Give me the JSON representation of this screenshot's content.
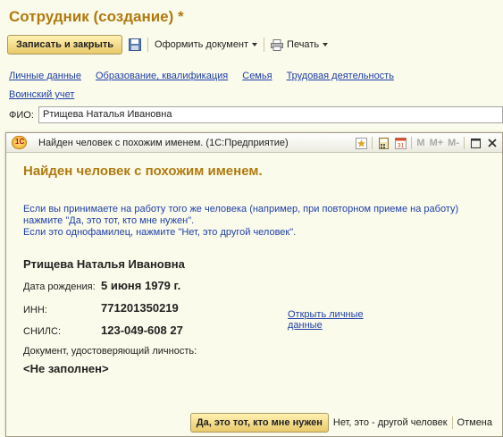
{
  "form": {
    "title": "Сотрудник (создание) *",
    "toolbar": {
      "save_close": "Записать и закрыть",
      "format_doc": "Оформить документ",
      "print": "Печать"
    },
    "tabs_row1": [
      "Личные данные",
      "Образование, квалификация",
      "Семья",
      "Трудовая деятельность"
    ],
    "tabs_row2": [
      "Воинский учет"
    ],
    "fio_label": "ФИО:",
    "fio_value": "Ртищева Наталья Ивановна"
  },
  "dialog": {
    "title": "Найден человек с похожим именем.  (1С:Предприятие)",
    "header_buttons": {
      "m": "M",
      "m_plus": "M+",
      "m_minus": "M-"
    },
    "heading": "Найден человек с похожим именем.",
    "desc_line1": "Если вы принимаете на работу того же человека (например, при повторном приеме на работу)",
    "desc_line2": "нажмите \"Да, это тот, кто мне нужен\".",
    "desc_line3": "Если это однофамилец, нажмите \"Нет, это другой человек\".",
    "person_name": "Ртищева Наталья Ивановна",
    "birth_label": "Дата рождения:",
    "birth_value": "5 июня 1979 г.",
    "inn_label": "ИНН:",
    "inn_value": "771201350219",
    "snils_label": "СНИЛС:",
    "snils_value": "123-049-608 27",
    "open_link_line1": "Открыть личные",
    "open_link_line2": "данные",
    "doc_label": "Документ, удостоверяющий личность:",
    "doc_value": "<Не заполнен>",
    "btn_yes": "Да, это тот, кто мне нужен",
    "btn_no": "Нет, это - другой человек",
    "btn_cancel": "Отмена"
  },
  "colors": {
    "accent": "#b07a10",
    "link": "#1f3fa8",
    "background": "#fbfbeb"
  }
}
